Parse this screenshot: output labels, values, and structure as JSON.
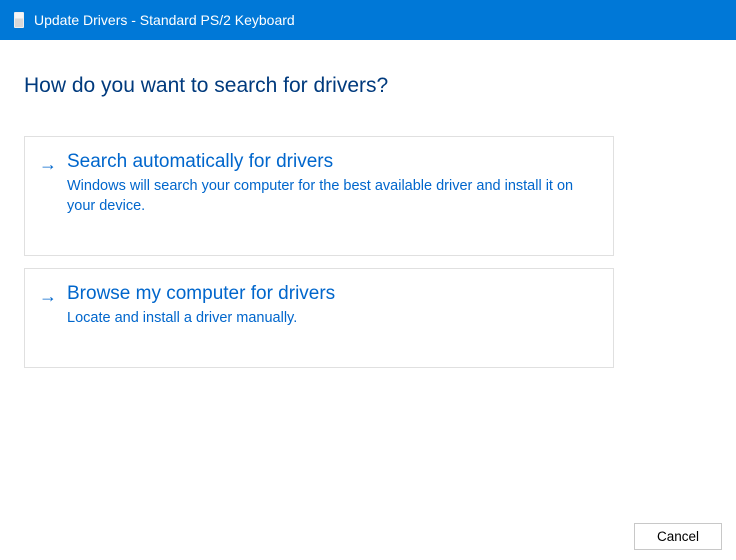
{
  "titlebar": {
    "title": "Update Drivers - Standard PS/2 Keyboard"
  },
  "heading": "How do you want to search for drivers?",
  "options": [
    {
      "title": "Search automatically for drivers",
      "description": "Windows will search your computer for the best available driver and install it on your device."
    },
    {
      "title": "Browse my computer for drivers",
      "description": "Locate and install a driver manually."
    }
  ],
  "footer": {
    "cancel_label": "Cancel"
  }
}
